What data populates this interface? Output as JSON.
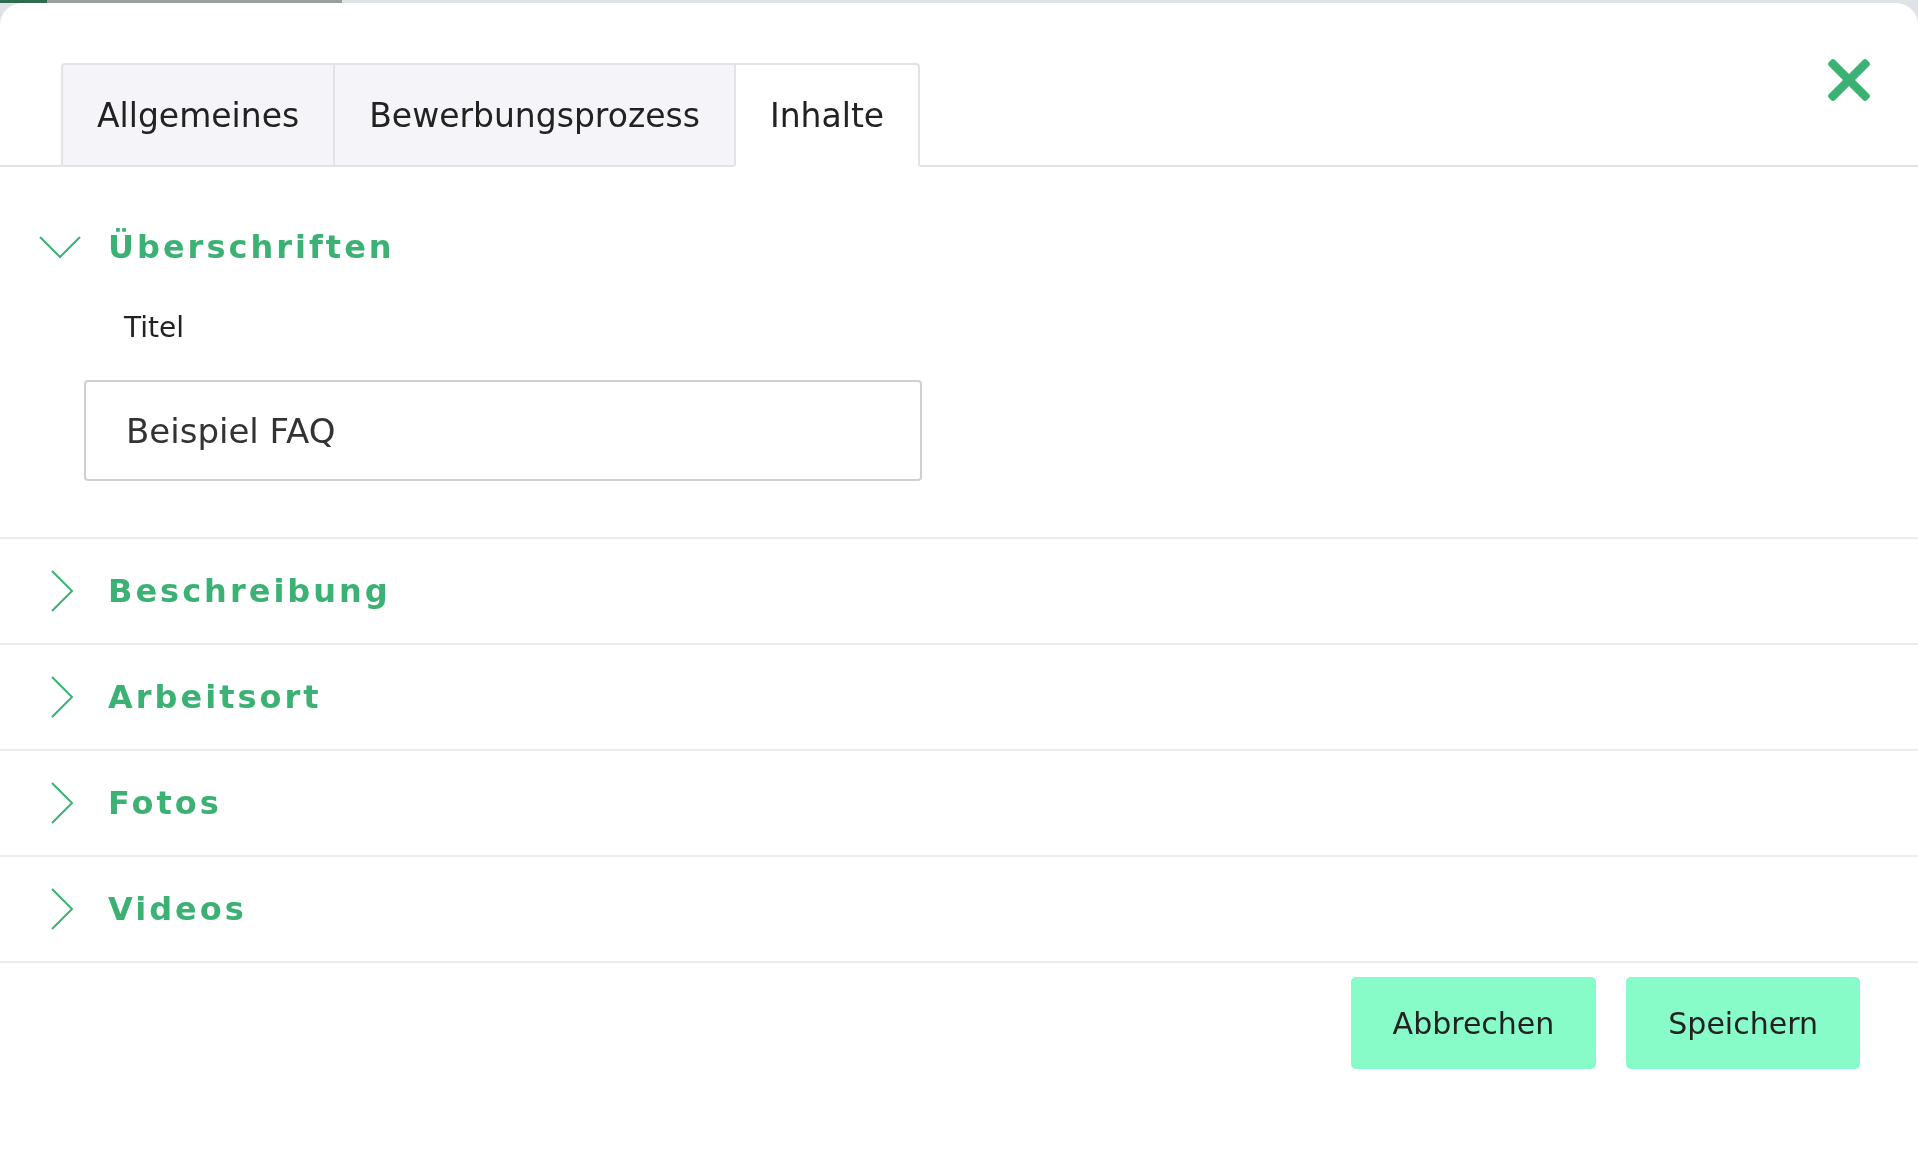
{
  "loading_bar": {
    "level": 0.137
  },
  "tabs": [
    {
      "label": "Allgemeines",
      "selected": false
    },
    {
      "label": "Bewerbungsprozess",
      "selected": false
    },
    {
      "label": "Inhalte",
      "selected": true
    }
  ],
  "sections": [
    {
      "title": "Überschriften",
      "expanded": true,
      "fields": [
        {
          "label": "Titel",
          "value": "Beispiel FAQ"
        }
      ]
    },
    {
      "title": "Beschreibung",
      "expanded": false
    },
    {
      "title": "Arbeitsort",
      "expanded": false
    },
    {
      "title": "Fotos",
      "expanded": false
    },
    {
      "title": "Videos",
      "expanded": false
    }
  ],
  "buttons": [
    "Abbrechen",
    "Speichern"
  ]
}
